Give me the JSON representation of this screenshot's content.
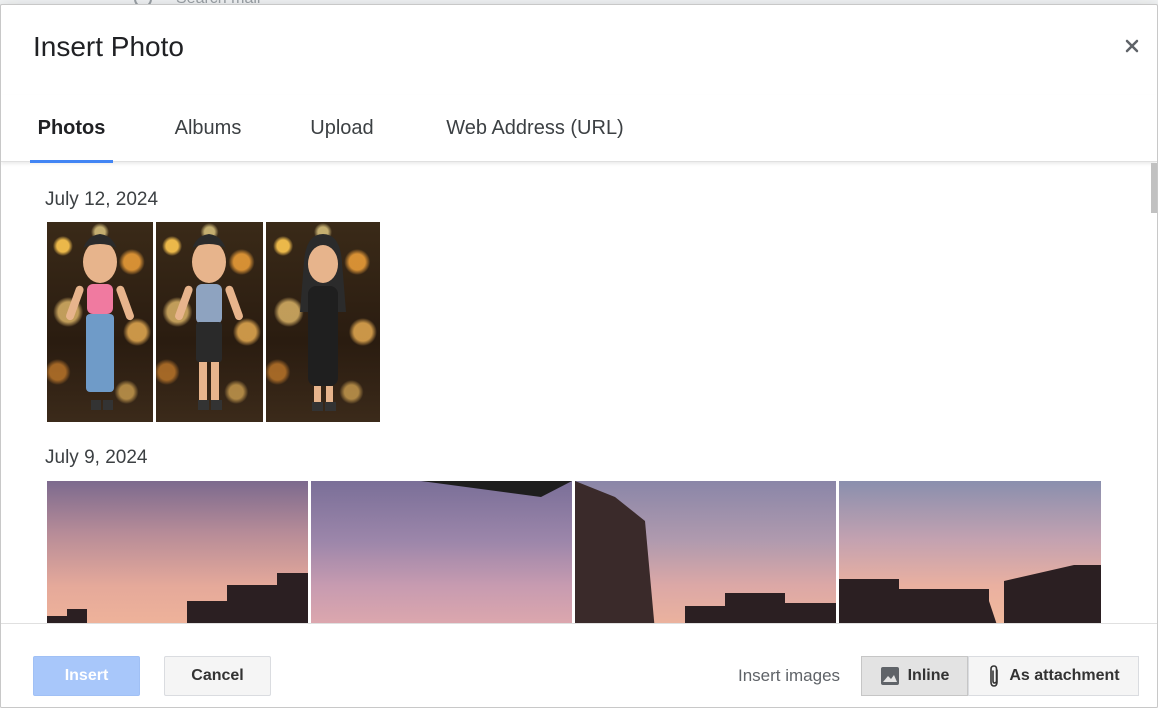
{
  "background": {
    "search_placeholder": "Search mail"
  },
  "dialog": {
    "title": "Insert Photo",
    "close_icon": "close-icon"
  },
  "tabs": [
    {
      "label": "Photos",
      "active": true
    },
    {
      "label": "Albums",
      "active": false
    },
    {
      "label": "Upload",
      "active": false
    },
    {
      "label": "Web Address (URL)",
      "active": false
    }
  ],
  "photo_groups": [
    {
      "date": "July 12, 2024"
    },
    {
      "date": "July 9, 2024"
    }
  ],
  "footer": {
    "insert_label": "Insert",
    "cancel_label": "Cancel",
    "insert_images_label": "Insert images",
    "inline_label": "Inline",
    "attachment_label": "As attachment"
  },
  "colors": {
    "accent": "#4285f4",
    "insert_button_disabled": "#a8c7fa"
  }
}
